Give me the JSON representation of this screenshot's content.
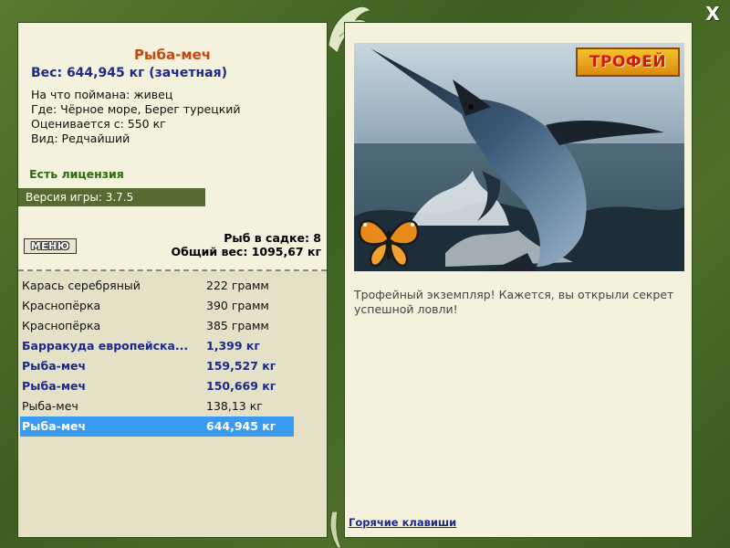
{
  "window": {
    "close_label": "X"
  },
  "left": {
    "fish_title": "Рыба-меч",
    "weight_line": "Вес: 644,945 кг (зачетная)",
    "details": [
      "На что поймана: живец",
      "Где: Чёрное море, Берег турецкий",
      "Оценивается с: 550 кг",
      "Вид: Редчайший"
    ],
    "license": "Есть лицензия",
    "version": "Версия игры: 3.7.5",
    "menu_label": "МЕНЮ",
    "cage_count": "Рыб в садке: 8",
    "cage_weight": "Общий вес: 1095,67 кг",
    "catch_list": [
      {
        "name": "Карась серебряный",
        "weight": "222 грамм",
        "style": "normal"
      },
      {
        "name": "Краснопёрка",
        "weight": "390 грамм",
        "style": "normal"
      },
      {
        "name": "Краснопёрка",
        "weight": "385 грамм",
        "style": "normal"
      },
      {
        "name": "Барракуда европейска...",
        "weight": "1,399 кг",
        "style": "bold"
      },
      {
        "name": "Рыба-меч",
        "weight": "159,527 кг",
        "style": "bold"
      },
      {
        "name": "Рыба-меч",
        "weight": "150,669 кг",
        "style": "bold"
      },
      {
        "name": "Рыба-меч",
        "weight": "138,13 кг",
        "style": "normal"
      },
      {
        "name": "Рыба-меч",
        "weight": "644,945 кг",
        "style": "selected"
      }
    ]
  },
  "right": {
    "trophy_badge": "ТРОФЕЙ",
    "caption": "Трофейный экземпляр! Кажется, вы открыли секрет успешной ловли!",
    "hotkeys_link": "Горячие клавиши"
  },
  "colors": {
    "frame_green": "#4a6a2c",
    "panel_bg": "#f4f1dc",
    "title_orange": "#c24a12",
    "accent_blue": "#1e2a8a",
    "license_green": "#2b6a12",
    "selection_blue": "#3a9cf0"
  }
}
